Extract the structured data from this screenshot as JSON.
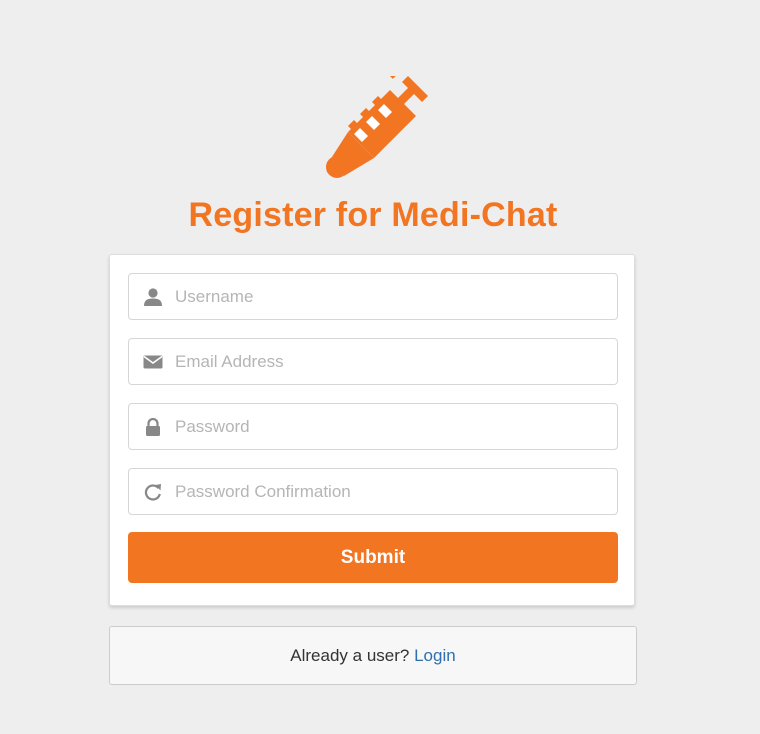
{
  "logo": {
    "icon": "syringe-icon",
    "color": "#f27522"
  },
  "title": "Register for Medi-Chat",
  "form": {
    "fields": [
      {
        "icon": "user-icon",
        "placeholder": "Username",
        "value": ""
      },
      {
        "icon": "envelope-icon",
        "placeholder": "Email Address",
        "value": ""
      },
      {
        "icon": "lock-icon",
        "placeholder": "Password",
        "value": ""
      },
      {
        "icon": "refresh-icon",
        "placeholder": "Password Confirmation",
        "value": ""
      }
    ],
    "submit_label": "Submit"
  },
  "login": {
    "prompt": "Already a user?",
    "link_label": "Login"
  },
  "colors": {
    "accent": "#f27522",
    "link": "#2f6faf",
    "background": "#eeeeee",
    "icon": "#888888"
  }
}
